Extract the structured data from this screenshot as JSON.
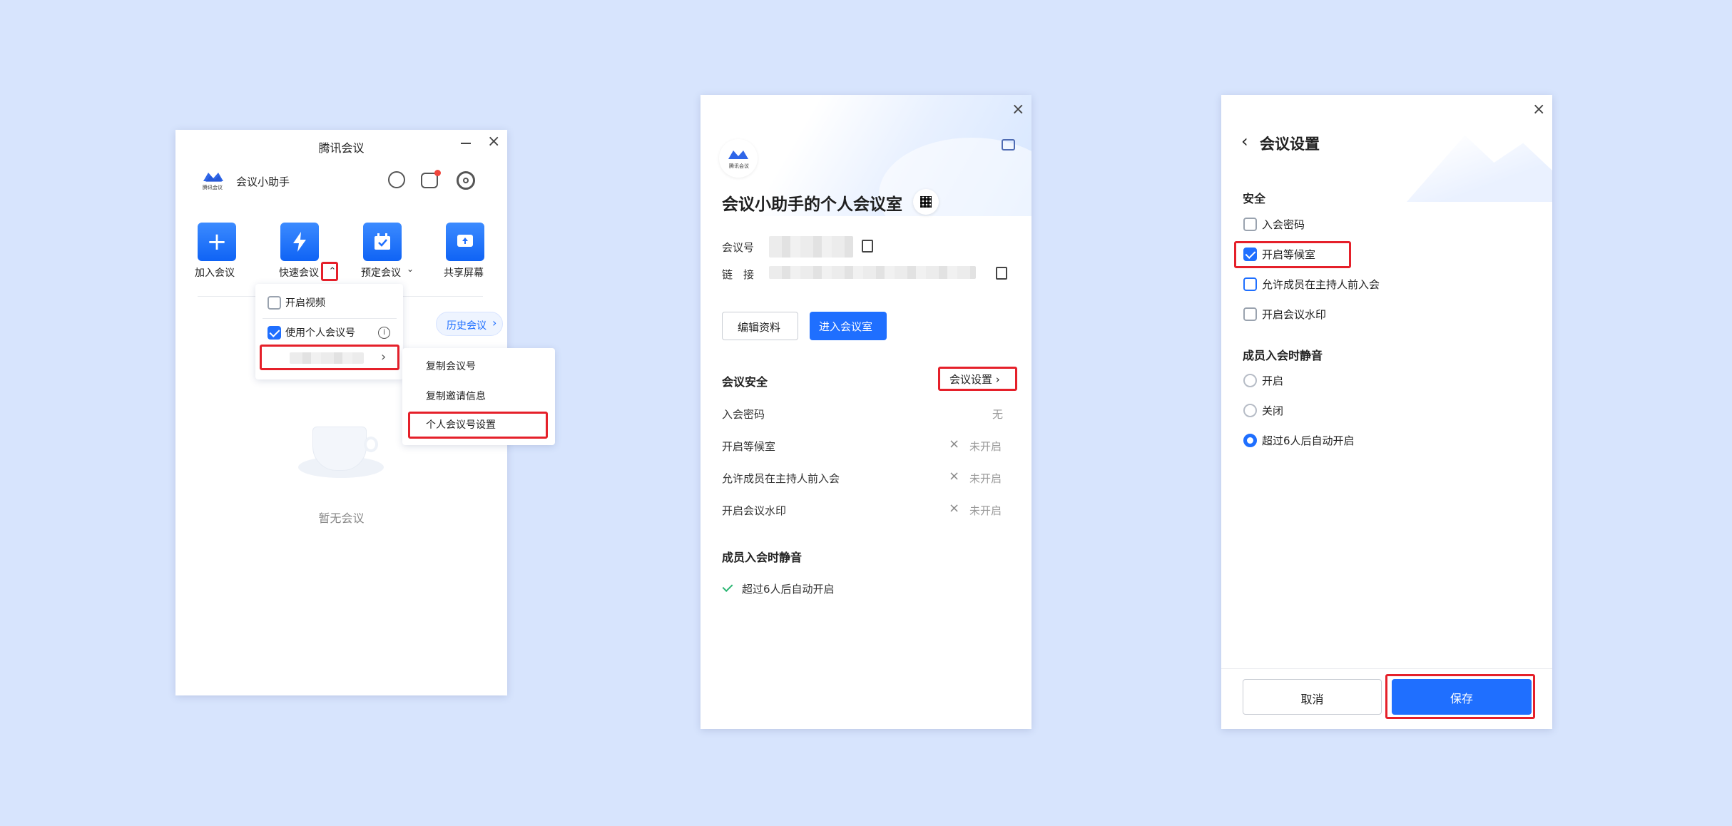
{
  "w1": {
    "title": "腾讯会议",
    "logo_text": "腾讯会议",
    "user_name": "会议小助手",
    "actions": [
      "加入会议",
      "快速会议",
      "预定会议",
      "共享屏幕"
    ],
    "history_link": "历史会议",
    "empty_text": "暂无会议",
    "dropdown": {
      "open_video": "开启视频",
      "use_pmi": "使用个人会议号"
    },
    "submenu": [
      "复制会议号",
      "复制邀请信息",
      "个人会议号设置"
    ]
  },
  "w2": {
    "logo_text": "腾讯会议",
    "room_title": "会议小助手的个人会议室",
    "meeting_id_label": "会议号",
    "link_label": "链　接",
    "edit_button": "编辑资料",
    "enter_button": "进入会议室",
    "security_heading": "会议安全",
    "settings_link": "会议设置",
    "rows": [
      {
        "label": "入会密码",
        "value": "无"
      },
      {
        "label": "开启等候室",
        "value": "未开启"
      },
      {
        "label": "允许成员在主持人前入会",
        "value": "未开启"
      },
      {
        "label": "开启会议水印",
        "value": "未开启"
      }
    ],
    "mute_heading": "成员入会时静音",
    "mute_value": "超过6人后自动开启"
  },
  "w3": {
    "title": "会议设置",
    "security_heading": "安全",
    "options": [
      "入会密码",
      "开启等候室",
      "允许成员在主持人前入会",
      "开启会议水印"
    ],
    "mute_heading": "成员入会时静音",
    "mute_options": [
      "开启",
      "关闭",
      "超过6人后自动开启"
    ],
    "cancel_button": "取消",
    "save_button": "保存"
  },
  "colors": {
    "accent": "#1f6fff",
    "highlight": "#e5202a",
    "background": "#d7e4fd"
  }
}
